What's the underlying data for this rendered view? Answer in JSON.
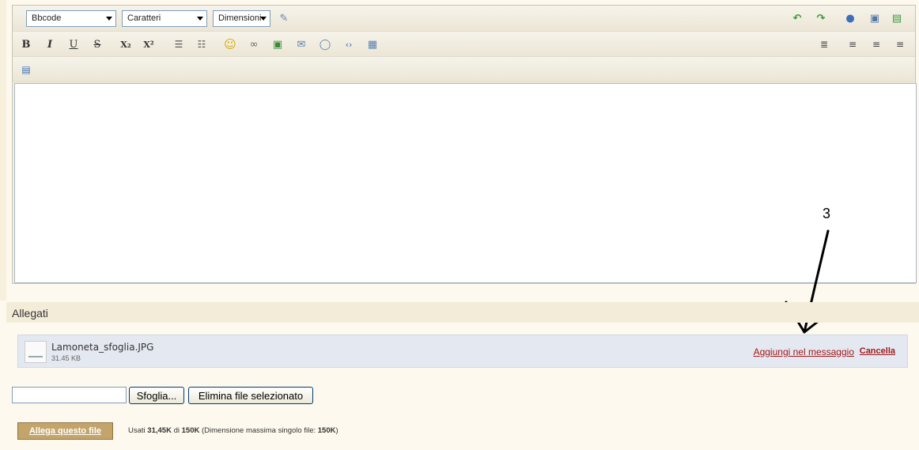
{
  "editor": {
    "toolbar_row1": {
      "bbcode_select": "Bbcode",
      "font_select": "Caratteri",
      "size_select": "Dimensioni",
      "icons": [
        "format-wand-icon",
        "undo-icon",
        "redo-icon",
        "help-icon",
        "save-draft-icon",
        "load-draft-icon"
      ]
    },
    "toolbar_row2": {
      "bold": "B",
      "italic": "I",
      "underline": "U",
      "strike": "S",
      "subscript": "X₂",
      "superscript": "X²",
      "icons": [
        "bullet-list-icon",
        "numbered-list-icon",
        "smiley-icon",
        "link-icon",
        "image-icon",
        "email-icon",
        "quote-icon",
        "code-icon",
        "media-icon",
        "indent-icon",
        "align-left-icon",
        "align-center-icon",
        "align-right-icon"
      ]
    },
    "toolbar_row3": {
      "icons": [
        "source-mode-icon"
      ]
    },
    "content": ""
  },
  "annotation": {
    "label": "3"
  },
  "attachments": {
    "title": "Allegati",
    "items": [
      {
        "name": "Lamoneta_sfoglia.JPG",
        "size": "31.45 KB",
        "add_label": "Aggiungi nel messaggio",
        "cancel_label": "Cancella"
      }
    ],
    "browse_label": "Sfoglia...",
    "delete_selected_label": "Elimina file selezionato",
    "attach_label": "Allega questo file",
    "usage": {
      "prefix": "Usati ",
      "used": "31,45K",
      "of": " di ",
      "total": "150K",
      "max_prefix": " (Dimensione massima singolo file: ",
      "max": "150K",
      "suffix": ")"
    }
  },
  "colors": {
    "link": "#a0181a",
    "attach_button": "#c3a46b",
    "background": "#fdf9ee"
  }
}
